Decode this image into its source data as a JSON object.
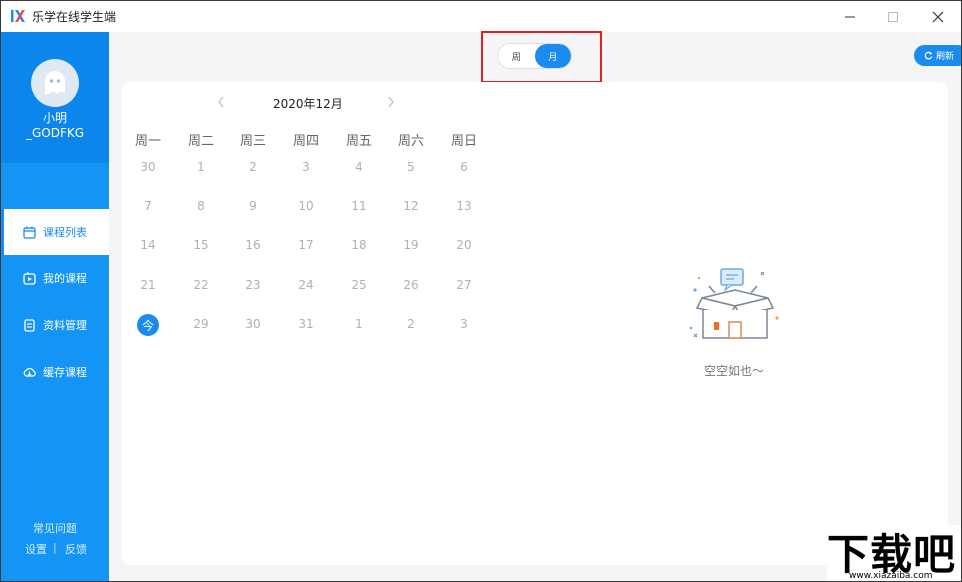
{
  "window": {
    "title": "乐学在线学生端",
    "logo_icon": "lexue-logo-icon",
    "controls": [
      "minimize-icon",
      "maximize-icon",
      "close-icon"
    ]
  },
  "sidebar": {
    "user": {
      "name_line1": "小明",
      "name_line2": "_GODFKG",
      "avatar_icon": "ghost-avatar-icon"
    },
    "items": [
      {
        "label": "课程列表",
        "icon": "calendar-icon",
        "active": true
      },
      {
        "label": "我的课程",
        "icon": "play-box-icon",
        "active": false
      },
      {
        "label": "资料管理",
        "icon": "document-stack-icon",
        "active": false
      },
      {
        "label": "缓存课程",
        "icon": "cloud-download-icon",
        "active": false
      }
    ],
    "footer": {
      "faq": "常见问题",
      "settings": "设置",
      "separator": "|",
      "feedback": "反馈"
    }
  },
  "toolbar": {
    "view_toggle": {
      "week": "周",
      "month": "月",
      "selected": "月"
    },
    "refresh_label": "刷新",
    "refresh_icon": "refresh-icon"
  },
  "calendar": {
    "month_title": "2020年12月",
    "prev_icon": "chevron-left-icon",
    "next_icon": "chevron-right-icon",
    "weekdays": [
      "周一",
      "周二",
      "周三",
      "周四",
      "周五",
      "周六",
      "周日"
    ],
    "weeks": [
      [
        "30",
        "1",
        "2",
        "3",
        "4",
        "5",
        "6"
      ],
      [
        "7",
        "8",
        "9",
        "10",
        "11",
        "12",
        "13"
      ],
      [
        "14",
        "15",
        "16",
        "17",
        "18",
        "19",
        "20"
      ],
      [
        "21",
        "22",
        "23",
        "24",
        "25",
        "26",
        "27"
      ],
      [
        "今",
        "29",
        "30",
        "31",
        "1",
        "2",
        "3"
      ]
    ],
    "today_label": "今"
  },
  "empty_state": {
    "text": "空空如也～",
    "icon": "empty-box-icon"
  },
  "watermark": {
    "big": "下载吧",
    "small": "www.xiazaiba.com"
  },
  "colors": {
    "accent": "#1a8cf0",
    "sidebar": "#1495f5",
    "sidebar_header": "#0c86ea",
    "highlight": "#e02020"
  }
}
